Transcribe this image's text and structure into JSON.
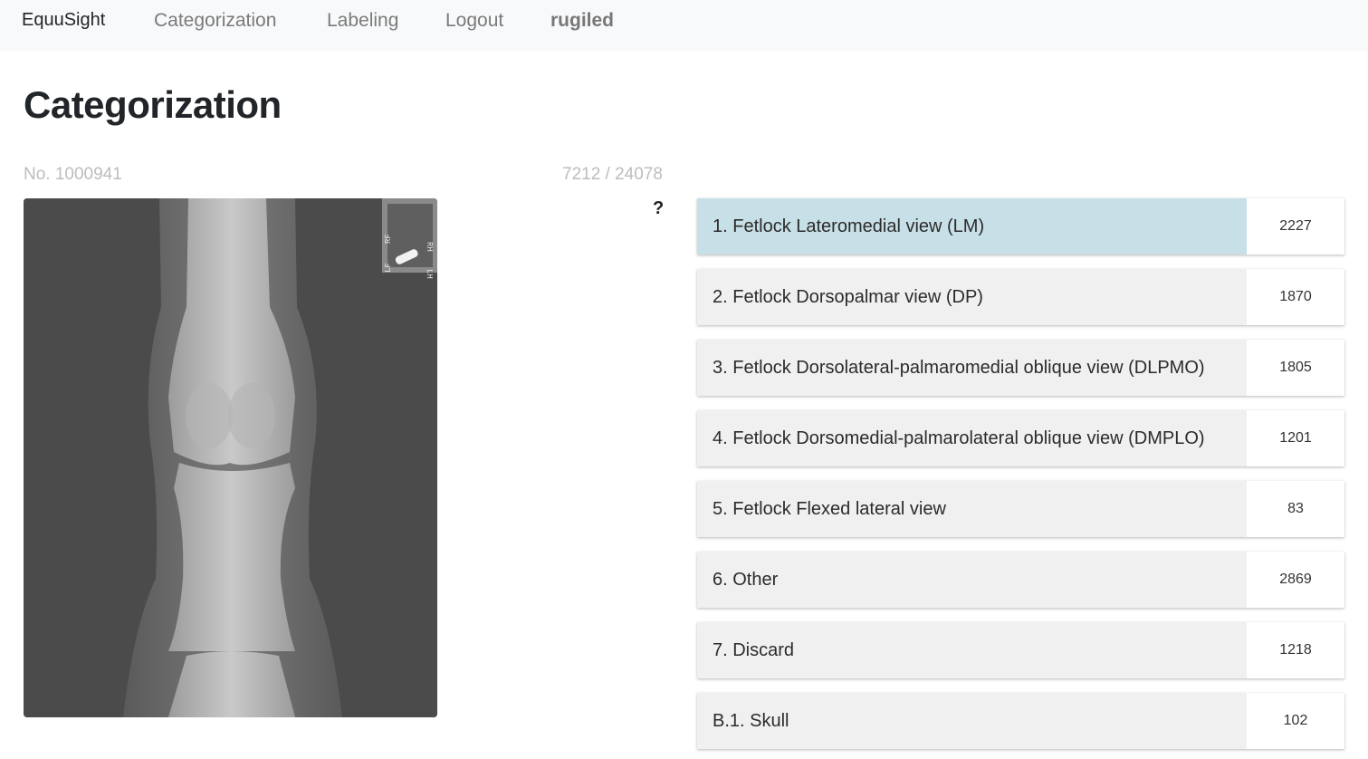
{
  "nav": {
    "brand": "EquuSight",
    "links": [
      "Categorization",
      "Labeling",
      "Logout"
    ],
    "user": "rugiled"
  },
  "page": {
    "title": "Categorization",
    "image_number": "No. 1000941",
    "progress": "7212 / 24078",
    "help": "?"
  },
  "xray": {
    "marker_top": "RF",
    "marker_right": "RH",
    "marker_left": "LF",
    "marker_bottom_right": "LH"
  },
  "categories": [
    {
      "label": "1. Fetlock Lateromedial view (LM)",
      "count": "2227",
      "selected": true
    },
    {
      "label": "2. Fetlock Dorsopalmar view (DP)",
      "count": "1870",
      "selected": false
    },
    {
      "label": "3. Fetlock Dorsolateral-palmaromedial oblique view (DLPMO)",
      "count": "1805",
      "selected": false
    },
    {
      "label": "4. Fetlock Dorsomedial-palmarolateral oblique view (DMPLO)",
      "count": "1201",
      "selected": false
    },
    {
      "label": "5. Fetlock Flexed lateral view",
      "count": "83",
      "selected": false
    },
    {
      "label": "6. Other",
      "count": "2869",
      "selected": false
    },
    {
      "label": "7. Discard",
      "count": "1218",
      "selected": false
    },
    {
      "label": "B.1. Skull",
      "count": "102",
      "selected": false
    }
  ],
  "colors": {
    "selected": "#c7dfe6",
    "item_bg": "#f0f0f0",
    "navbar_bg": "#f8f9fa"
  }
}
